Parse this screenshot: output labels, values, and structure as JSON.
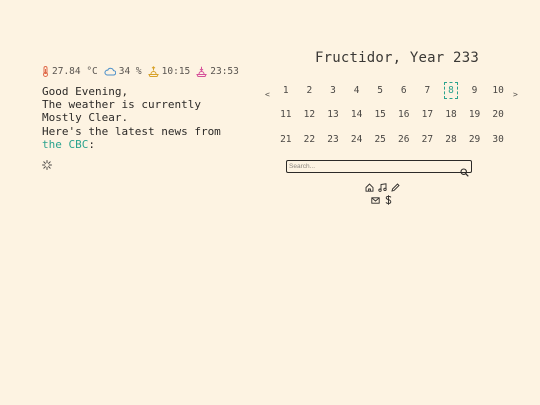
{
  "stats": {
    "temperature": "27.84 °C",
    "humidity": "34 %",
    "sunrise": "10:15",
    "sunset": "23:53"
  },
  "greeting": {
    "line1": "Good Evening,",
    "line2": "The weather is currently Mostly Clear.",
    "news_prefix": "Here's the latest news from ",
    "news_source": "the CBC",
    "news_suffix": ":"
  },
  "calendar": {
    "title": "Fructidor, Year 233",
    "prev": "<",
    "next": ">",
    "weeks": [
      [
        "1",
        "2",
        "3",
        "4",
        "5",
        "6",
        "7",
        "8",
        "9",
        "10"
      ],
      [
        "11",
        "12",
        "13",
        "14",
        "15",
        "16",
        "17",
        "18",
        "19",
        "20"
      ],
      [
        "21",
        "22",
        "23",
        "24",
        "25",
        "26",
        "27",
        "28",
        "29",
        "30"
      ]
    ],
    "today": "8"
  },
  "search": {
    "placeholder": "Search..."
  },
  "colors": {
    "background": "#fdf3e2",
    "accent": "#2aa38e",
    "temp": "#e06a4a",
    "humidity": "#4a8fc9",
    "sunrise": "#d8a22a",
    "sunset": "#d6509a"
  }
}
